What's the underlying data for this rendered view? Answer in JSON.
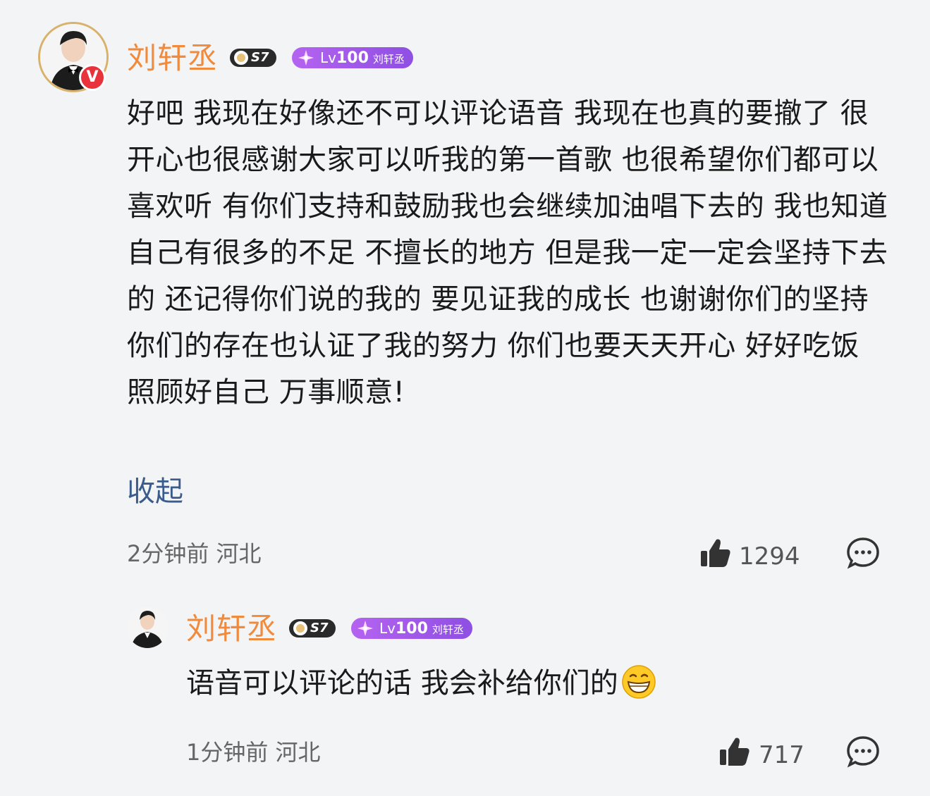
{
  "comment": {
    "username": "刘轩丞",
    "badge_s": "S7",
    "level_prefix": "Lv",
    "level_number": "100",
    "level_name": "刘轩丞",
    "verified_mark": "V",
    "text": "好吧 我现在好像还不可以评论语音 我现在也真的要撤了 很开心也很感谢大家可以听我的第一首歌 也很希望你们都可以喜欢听 有你们支持和鼓励我也会继续加油唱下去的 我也知道自己有很多的不足 不擅长的地方 但是我一定一定会坚持下去的 还记得你们说的我的 要见证我的成长 也谢谢你们的坚持 你们的存在也认证了我的努力 你们也要天天开心 好好吃饭 照顾好自己 万事顺意!",
    "collapse_label": "收起",
    "time": "2分钟前 河北",
    "likes": "1294"
  },
  "reply": {
    "username": "刘轩丞",
    "badge_s": "S7",
    "level_prefix": "Lv",
    "level_number": "100",
    "level_name": "刘轩丞",
    "text": "语音可以评论的话 我会补给你们的",
    "emoji": "grinning-face",
    "time": "1分钟前 河北",
    "likes": "717"
  },
  "colors": {
    "username": "#f08a3c",
    "link": "#3a5b8c",
    "level_badge": "#9b57e8",
    "background": "#f3f4f6"
  }
}
